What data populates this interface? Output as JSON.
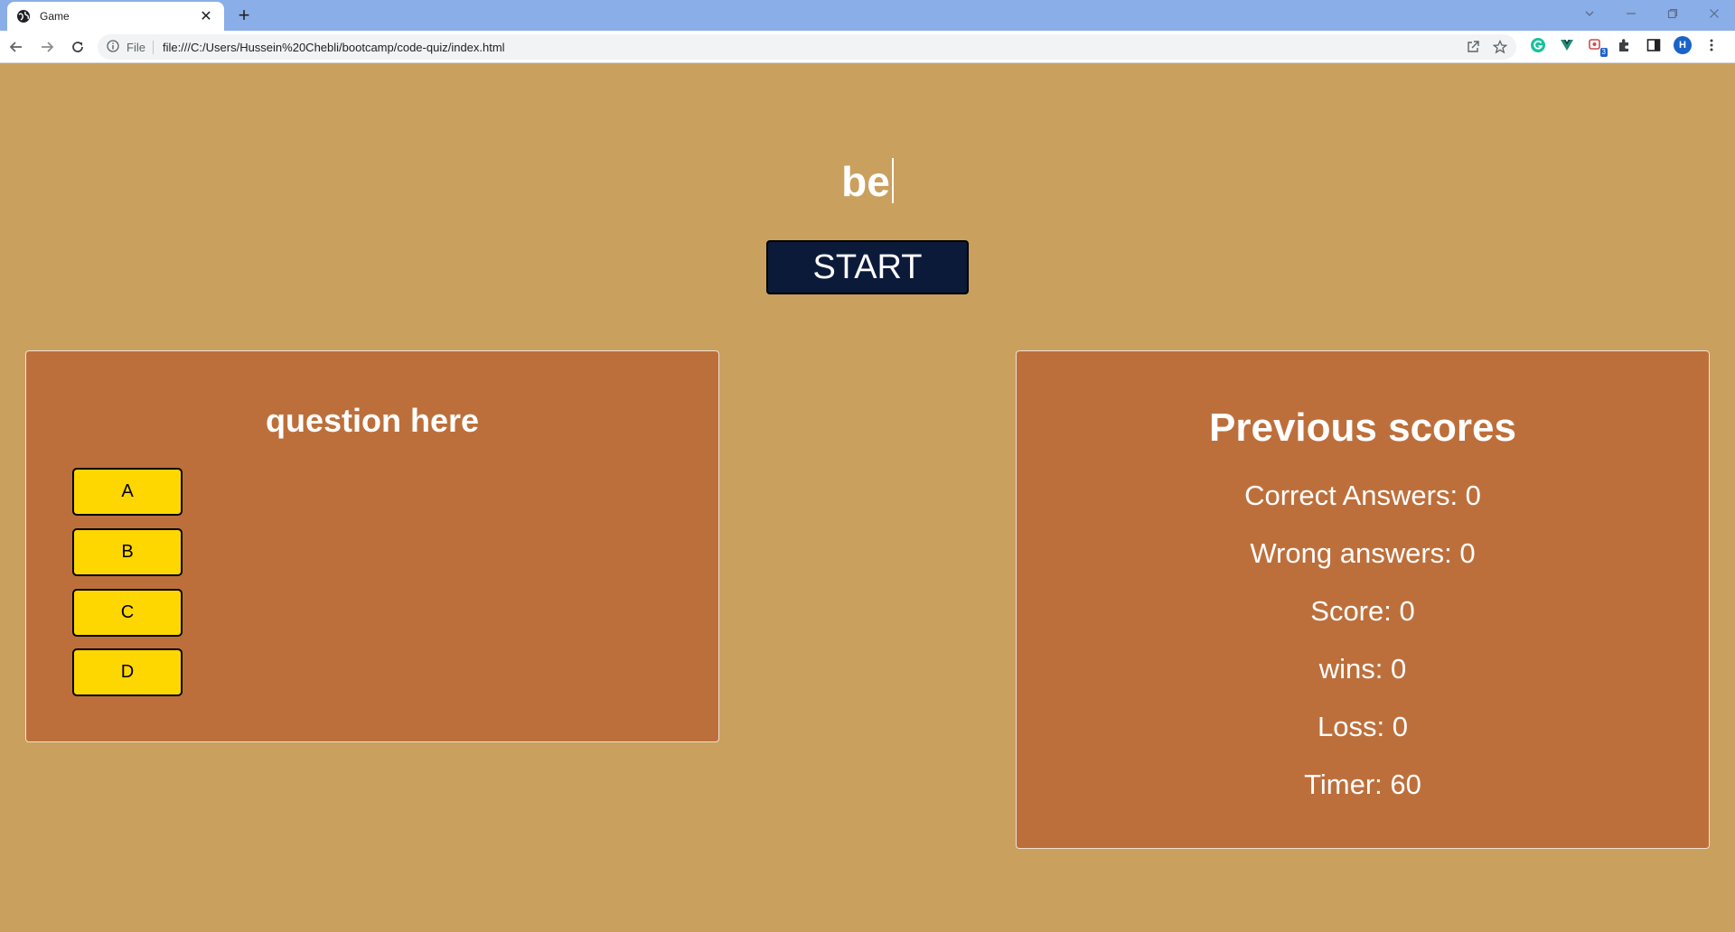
{
  "browser": {
    "tab_title": "Game",
    "tab_close": "✕",
    "new_tab": "+",
    "omnibox_scheme": "File",
    "url": "file:///C:/Users/Hussein%20Chebli/bootcamp/code-quiz/index.html",
    "profile_initial": "H",
    "extension_badge": "3"
  },
  "page": {
    "typed_text": "be",
    "start_label": "START"
  },
  "quiz": {
    "question": "question here",
    "answers": [
      "A",
      "B",
      "C",
      "D"
    ]
  },
  "scores": {
    "title": "Previous scores",
    "correct": "Correct Answers: 0",
    "wrong": "Wrong answers: 0",
    "score": "Score: 0",
    "wins": "wins: 0",
    "loss": "Loss: 0",
    "timer": "Timer: 60"
  },
  "colors": {
    "page_bg": "#caa05e",
    "panel_bg": "#bd6f3b",
    "start_bg": "#0c1a3a",
    "answer_bg": "#ffd700",
    "tabstrip_bg": "#8aaee8"
  }
}
